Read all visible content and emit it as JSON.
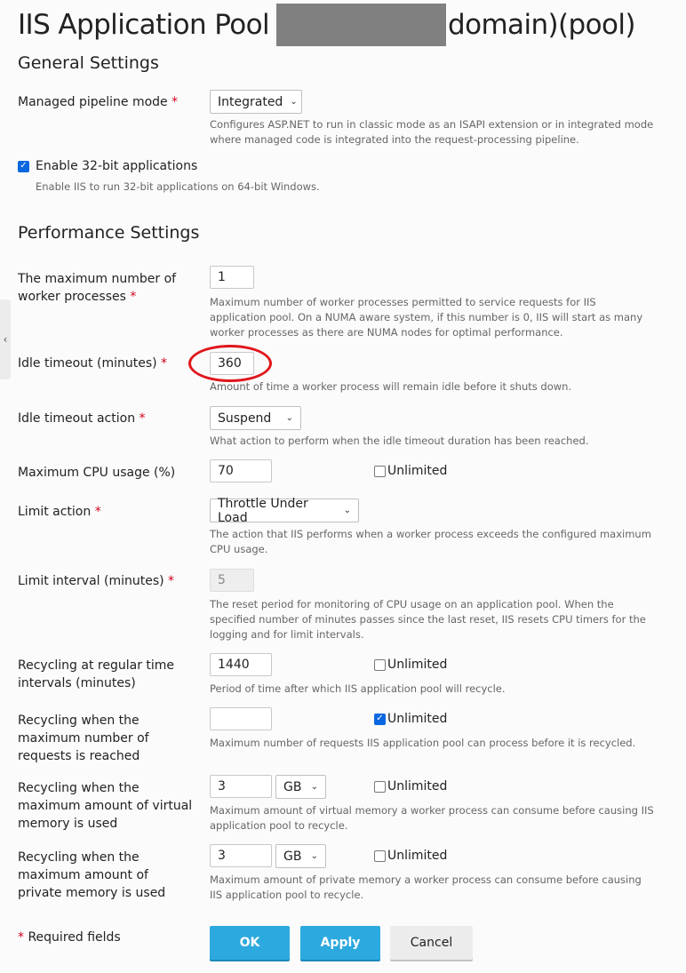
{
  "page": {
    "title_prefix": "IIS Application Pool",
    "title_suffix": "domain)(pool)"
  },
  "general": {
    "heading": "General Settings",
    "pipeline": {
      "label": "Managed pipeline mode",
      "required_mark": "*",
      "value": "Integrated",
      "description": "Configures ASP.NET to run in classic mode as an ISAPI extension or in integrated mode where managed code is integrated into the request-processing pipeline."
    },
    "enable32": {
      "label": "Enable 32-bit applications",
      "checked": true,
      "description": "Enable IIS to run 32-bit applications on 64-bit Windows."
    }
  },
  "performance": {
    "heading": "Performance Settings",
    "max_workers": {
      "label": "The maximum number of worker processes",
      "required_mark": "*",
      "value": "1",
      "description": "Maximum number of worker processes permitted to service requests for IIS application pool. On a NUMA aware system, if this number is 0, IIS will start as many worker processes as there are NUMA nodes for optimal performance."
    },
    "idle_timeout": {
      "label": "Idle timeout (minutes)",
      "required_mark": "*",
      "value": "360",
      "description": "Amount of time a worker process will remain idle before it shuts down.",
      "annotation_color": "#e0161b"
    },
    "idle_action": {
      "label": "Idle timeout action",
      "required_mark": "*",
      "value": "Suspend",
      "description": "What action to perform when the idle timeout duration has been reached."
    },
    "max_cpu": {
      "label": "Maximum CPU usage (%)",
      "value": "70",
      "unlimited_label": "Unlimited",
      "unlimited_checked": false
    },
    "limit_action": {
      "label": "Limit action",
      "required_mark": "*",
      "value": "Throttle Under Load",
      "description": "The action that IIS performs when a worker process exceeds the configured maximum CPU usage."
    },
    "limit_interval": {
      "label": "Limit interval (minutes)",
      "required_mark": "*",
      "value": "5",
      "disabled": true,
      "description": "The reset period for monitoring of CPU usage on an application pool. When the specified number of minutes passes since the last reset, IIS resets CPU timers for the logging and for limit intervals."
    },
    "recycle_time": {
      "label": "Recycling at regular time intervals (minutes)",
      "value": "1440",
      "unlimited_label": "Unlimited",
      "unlimited_checked": false,
      "description": "Period of time after which IIS application pool will recycle."
    },
    "recycle_requests": {
      "label": "Recycling when the maximum number of requests is reached",
      "value": "",
      "unlimited_label": "Unlimited",
      "unlimited_checked": true,
      "description": "Maximum number of requests IIS application pool can process before it is recycled."
    },
    "recycle_virtual": {
      "label": "Recycling when the maximum amount of virtual memory is used",
      "value": "3",
      "unit": "GB",
      "unlimited_label": "Unlimited",
      "unlimited_checked": false,
      "description": "Maximum amount of virtual memory a worker process can consume before causing IIS application pool to recycle."
    },
    "recycle_private": {
      "label": "Recycling when the maximum amount of private memory is used",
      "value": "3",
      "unit": "GB",
      "unlimited_label": "Unlimited",
      "unlimited_checked": false,
      "description": "Maximum amount of private memory a worker process can consume before causing IIS application pool to recycle."
    }
  },
  "footer": {
    "required_mark": "*",
    "required_note": "Required fields",
    "ok_label": "OK",
    "apply_label": "Apply",
    "cancel_label": "Cancel"
  },
  "icons": {
    "chevron": "⌄",
    "check": "✓",
    "collapse": "‹"
  },
  "colors": {
    "primary_button": "#2ca9de",
    "required": "#d0021b",
    "checkbox_checked": "#0a67e0"
  }
}
